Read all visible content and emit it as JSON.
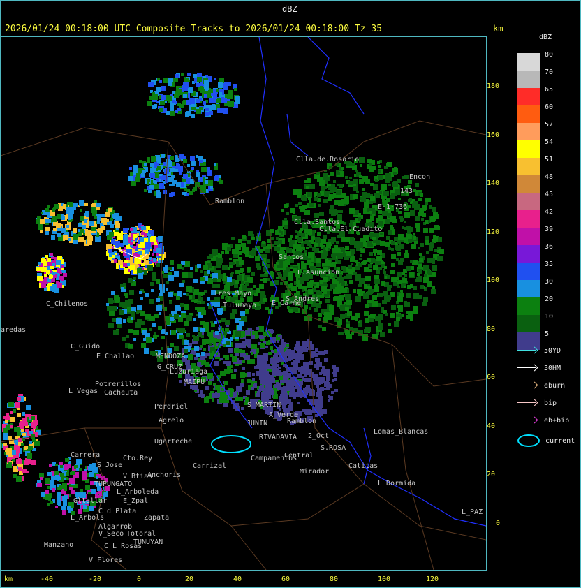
{
  "window": {
    "title": "dBZ"
  },
  "header": {
    "text": "2026/01/24 00:18:00 UTC Composite Tracks to 2026/01/24 00:18:00 Tz 35",
    "unit_right": "km",
    "unit_bottom": "km"
  },
  "legend": {
    "title": "dBZ",
    "scale": [
      {
        "label": "80",
        "color": "#d8d8d8"
      },
      {
        "label": "70",
        "color": "#b8b8b8"
      },
      {
        "label": "65",
        "color": "#ff2c28"
      },
      {
        "label": "60",
        "color": "#ff5c10"
      },
      {
        "label": "57",
        "color": "#ff9c5c"
      },
      {
        "label": "54",
        "color": "#ffff00"
      },
      {
        "label": "51",
        "color": "#f8c030"
      },
      {
        "label": "48",
        "color": "#d08838"
      },
      {
        "label": "45",
        "color": "#c86880"
      },
      {
        "label": "42",
        "color": "#e8208c"
      },
      {
        "label": "39",
        "color": "#c010a8"
      },
      {
        "label": "36",
        "color": "#7818d8"
      },
      {
        "label": "35",
        "color": "#2050f0"
      },
      {
        "label": "30",
        "color": "#1890e0"
      },
      {
        "label": "20",
        "color": "#0c8010"
      },
      {
        "label": "10",
        "color": "#0a6010"
      },
      {
        "label": "5",
        "color": "#403c8c"
      }
    ],
    "tracks": [
      {
        "label": "50YD",
        "color": "#40e0e0",
        "kind": "arrow"
      },
      {
        "label": "30HM",
        "color": "#ffffff",
        "kind": "arrow"
      },
      {
        "label": "eburn",
        "color": "#e8b880",
        "kind": "arrow"
      },
      {
        "label": "bip",
        "color": "#f8c8c8",
        "kind": "arrow"
      },
      {
        "label": "eb+bip",
        "color": "#e840e0",
        "kind": "arrow"
      },
      {
        "label": "current",
        "color": "#00e0ff",
        "kind": "ellipse"
      }
    ]
  },
  "axes": {
    "x_ticks": [
      "-40",
      "-20",
      "0",
      "20",
      "40",
      "60",
      "80",
      "100",
      "120"
    ],
    "y_ticks": [
      "180",
      "160",
      "140",
      "120",
      "100",
      "80",
      "60",
      "40",
      "20",
      "0"
    ]
  },
  "places": [
    {
      "name": "Clla.de.Rosario"
    },
    {
      "name": "Encon"
    },
    {
      "name": "143"
    },
    {
      "name": "E-1-736"
    },
    {
      "name": "Ramblon"
    },
    {
      "name": "Clla.Santos"
    },
    {
      "name": "Clla.El.Cuadito"
    },
    {
      "name": "Santos"
    },
    {
      "name": "L.Asuncion"
    },
    {
      "name": "C_Chilenos"
    },
    {
      "name": "aredas"
    },
    {
      "name": "C_Guido"
    },
    {
      "name": "E_Challao"
    },
    {
      "name": "MENDOZA"
    },
    {
      "name": "G_CRUZ"
    },
    {
      "name": "Luzuriaga"
    },
    {
      "name": "MAIPU"
    },
    {
      "name": "Potrerillos"
    },
    {
      "name": "L_Vegas"
    },
    {
      "name": "Cacheuta"
    },
    {
      "name": "Perdriel"
    },
    {
      "name": "Agrelo"
    },
    {
      "name": "S_MARTIN"
    },
    {
      "name": "JUNIN"
    },
    {
      "name": "A_Verde"
    },
    {
      "name": "Ramblon"
    },
    {
      "name": "RIVADAVIA"
    },
    {
      "name": "2_Oct"
    },
    {
      "name": "S.ROSA"
    },
    {
      "name": "Lomas_Blancas"
    },
    {
      "name": "Catitas"
    },
    {
      "name": "L_Dormida"
    },
    {
      "name": "Ugarteche"
    },
    {
      "name": "Carrizal"
    },
    {
      "name": "Campamentos"
    },
    {
      "name": "Central"
    },
    {
      "name": "Mirador"
    },
    {
      "name": "Carrera"
    },
    {
      "name": "Cto.Rey"
    },
    {
      "name": "S_Jose"
    },
    {
      "name": "V_Btias"
    },
    {
      "name": "Anchoris"
    },
    {
      "name": "TUPUNGATO"
    },
    {
      "name": "L_Arboleda"
    },
    {
      "name": "Gltallar"
    },
    {
      "name": "E_Zpal"
    },
    {
      "name": "C_d_Plata"
    },
    {
      "name": "L_Arbols"
    },
    {
      "name": "Algarrob"
    },
    {
      "name": "Zapata"
    },
    {
      "name": "V_Seco"
    },
    {
      "name": "Totoral"
    },
    {
      "name": "TUNUYAN"
    },
    {
      "name": "Manzano"
    },
    {
      "name": "C_L_Rosas"
    },
    {
      "name": "V_Flores"
    },
    {
      "name": "L_PAZ"
    },
    {
      "name": "Tres_Mayo"
    },
    {
      "name": "Tulumaya"
    },
    {
      "name": "E_Carmen"
    },
    {
      "name": "S_Andres"
    }
  ]
}
